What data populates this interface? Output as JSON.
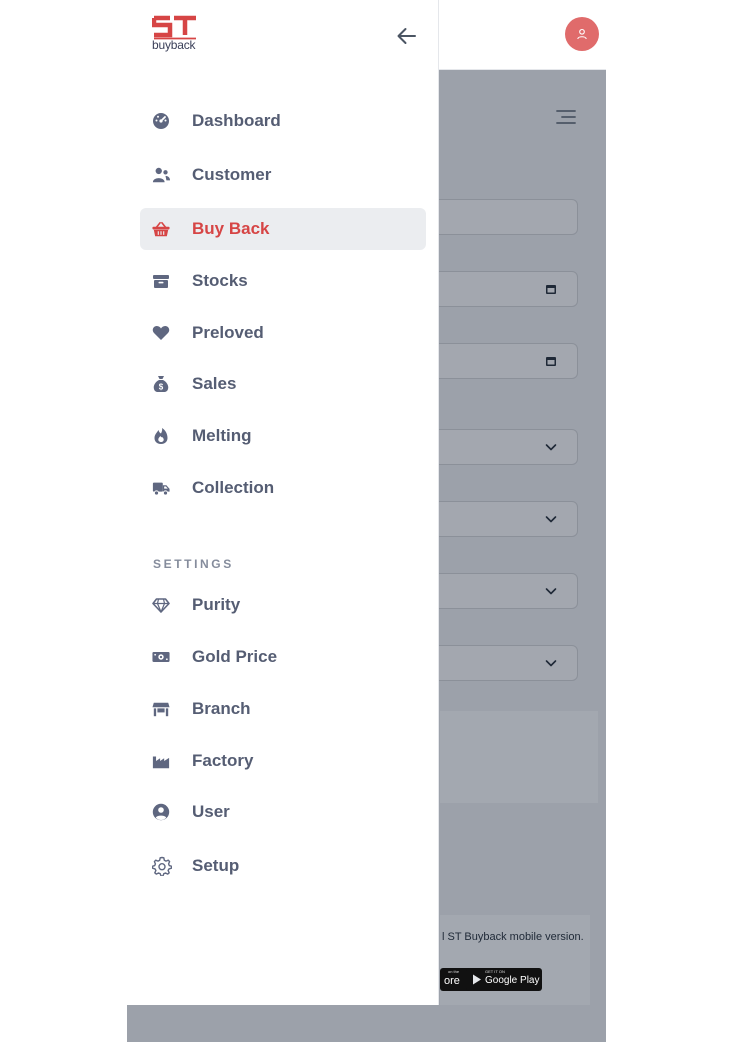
{
  "brand": {
    "logo_text": "buyback",
    "logo_mark": "ST",
    "accent": "#d64545"
  },
  "sidebar": {
    "main_items": [
      {
        "label": "Dashboard",
        "icon": "dashboard-icon",
        "active": false
      },
      {
        "label": "Customer",
        "icon": "users-icon",
        "active": false
      },
      {
        "label": "Buy Back",
        "icon": "basket-icon",
        "active": true
      },
      {
        "label": "Stocks",
        "icon": "box-icon",
        "active": false
      },
      {
        "label": "Preloved",
        "icon": "heart-icon",
        "active": false
      },
      {
        "label": "Sales",
        "icon": "money-bag-icon",
        "active": false
      },
      {
        "label": "Melting",
        "icon": "fire-icon",
        "active": false
      },
      {
        "label": "Collection",
        "icon": "truck-icon",
        "active": false
      }
    ],
    "settings_title": "SETTINGS",
    "settings_items": [
      {
        "label": "Purity",
        "icon": "gem-icon"
      },
      {
        "label": "Gold Price",
        "icon": "money-bill-icon"
      },
      {
        "label": "Branch",
        "icon": "store-icon"
      },
      {
        "label": "Factory",
        "icon": "factory-icon"
      },
      {
        "label": "User",
        "icon": "user-circle-icon"
      },
      {
        "label": "Setup",
        "icon": "gear-icon"
      }
    ]
  },
  "promo": {
    "text": "l ST Buyback mobile version.",
    "app_store_sub": "on the",
    "app_store_main": "ore",
    "google_play_sub": "GET IT ON",
    "google_play_main": "Google Play"
  }
}
